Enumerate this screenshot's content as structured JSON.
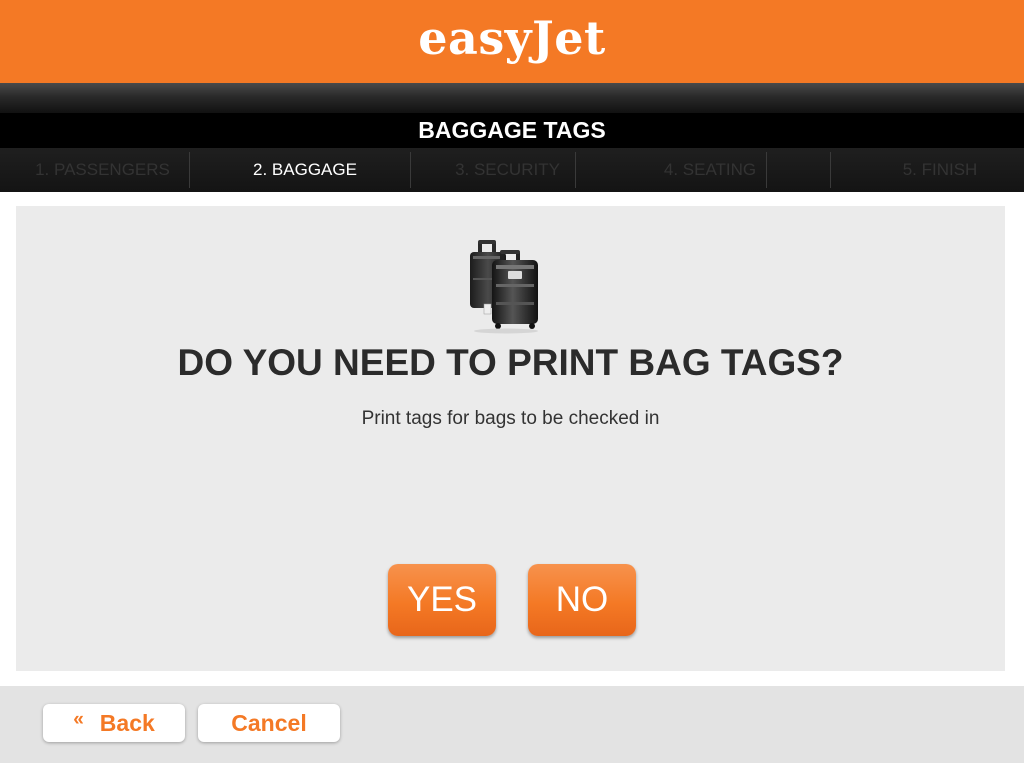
{
  "header": {
    "logo_text": "easyJet",
    "brand_color": "#f47925"
  },
  "title": "BAGGAGE TAGS",
  "steps": [
    {
      "label": "1. PASSENGERS",
      "active": false
    },
    {
      "label": "2. BAGGAGE",
      "active": true
    },
    {
      "label": "3. SECURITY",
      "active": false
    },
    {
      "label": "4. SEATING",
      "active": false
    },
    {
      "label": "5. FINISH",
      "active": false
    }
  ],
  "main": {
    "illustration_icon": "luggage-icon",
    "question": "DO YOU NEED TO PRINT BAG TAGS?",
    "subtext": "Print tags for bags to be checked in",
    "yes_label": "YES",
    "no_label": "NO"
  },
  "footer": {
    "back_icon": "«",
    "back_label": "Back",
    "cancel_label": "Cancel"
  }
}
